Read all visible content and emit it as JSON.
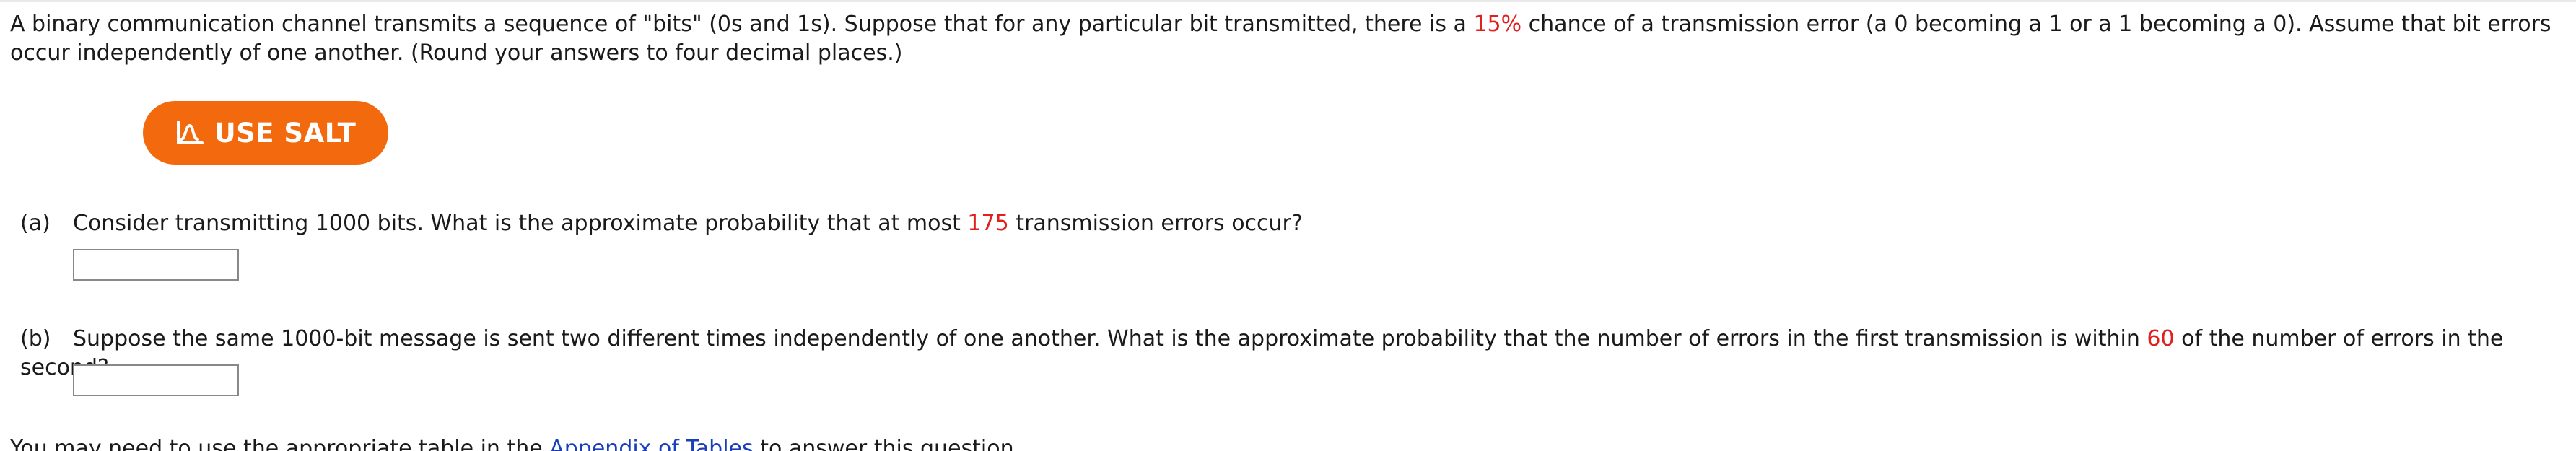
{
  "problem": {
    "text_before": "A binary communication channel transmits a sequence of \"bits\" (0s and 1s). Suppose that for any particular bit transmitted, there is a ",
    "error_percent": "15%",
    "text_after": " chance of a transmission error (a 0 becoming a 1 or a 1 becoming a 0). Assume that bit errors occur independently of one another. (Round your answers to four decimal places.)"
  },
  "salt_button": {
    "label": "USE SALT",
    "icon": "salt-chart-icon",
    "color": "#f26a0d"
  },
  "part_a": {
    "label": "(a)",
    "text_before": "Consider transmitting 1000 bits. What is the approximate probability that at most ",
    "value": "175",
    "text_after": " transmission errors occur?",
    "answer": ""
  },
  "part_b": {
    "label": "(b)",
    "text_before": "Suppose the same 1000-bit message is sent two different times independently of one another. What is the approximate probability that the number of errors in the first transmission is within ",
    "value": "60",
    "text_after": " of the number of errors in the second?",
    "answer": ""
  },
  "footnote": {
    "text_before": "You may need to use the appropriate table in the ",
    "link": "Appendix of Tables",
    "text_after": " to answer this question."
  },
  "colors": {
    "highlight": "#e01f1f",
    "link": "#1a3fb8"
  }
}
